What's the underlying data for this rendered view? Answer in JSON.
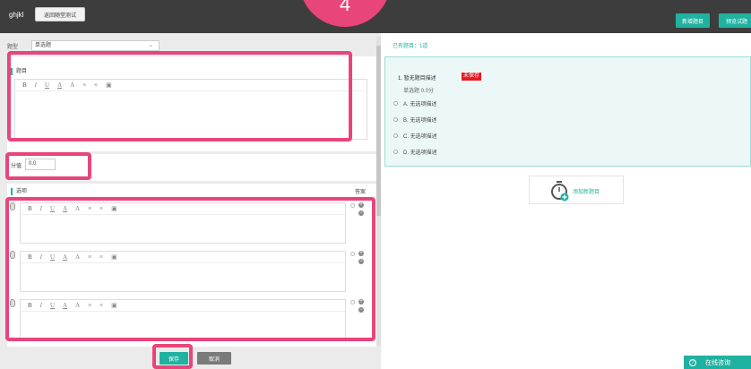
{
  "header": {
    "app_title": "ghjkl",
    "back_button": "返回随堂测试",
    "add_question": "新增题目",
    "preview_test": "预览试题",
    "step_number": "4"
  },
  "editor": {
    "type_label": "题型",
    "type_value": "单选题",
    "question_label": "题目",
    "score_label": "分值",
    "score_value": "0.0",
    "options_label": "选项",
    "answer_label": "答案",
    "toolbar": [
      "B",
      "I",
      "U",
      "A",
      "A",
      "≡",
      "≡",
      "▣"
    ],
    "save_button": "保存",
    "cancel_button": "取消"
  },
  "preview": {
    "count_text": "已有题目：1道",
    "question_title": "1. 暂无题目描述",
    "unsaved_badge": "未保存",
    "meta": "单选题 0.0分",
    "options": [
      "A. 无选项描述",
      "B. 无选项描述",
      "C. 无选项描述",
      "D. 无选项描述"
    ],
    "add_new_label": "添加新题目"
  },
  "consult": {
    "label": "在线咨询"
  },
  "colors": {
    "accent": "#20b2a0",
    "annotation": "#e8457a",
    "badge": "#e51c23",
    "topbar": "#3d3d3d"
  }
}
